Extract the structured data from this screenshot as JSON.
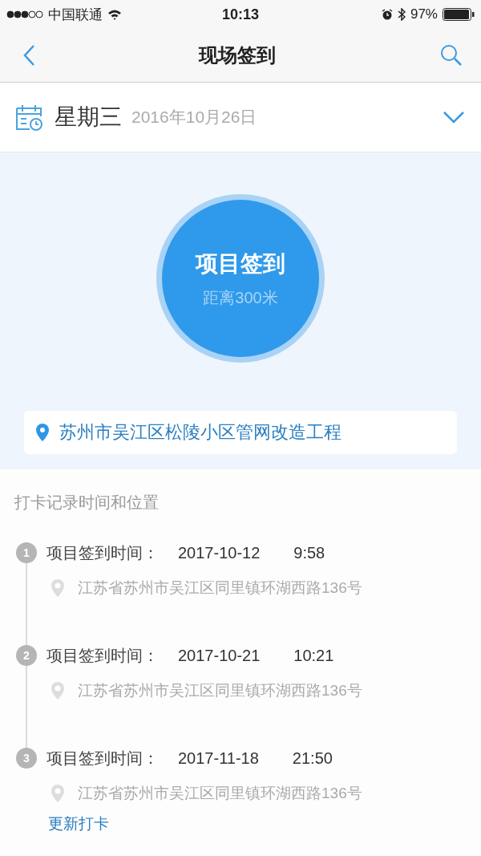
{
  "status_bar": {
    "carrier": "中国联通",
    "time": "10:13",
    "battery": "97%"
  },
  "nav": {
    "title": "现场签到"
  },
  "date_bar": {
    "weekday": "星期三",
    "date": "2016年10月26日"
  },
  "checkin": {
    "title": "项目签到",
    "distance": "距离300米"
  },
  "location": "苏州市吴江区松陵小区管网改造工程",
  "records_title": "打卡记录时间和位置",
  "records": [
    {
      "index": "1",
      "label": "项目签到时间：",
      "date": "2017-10-12",
      "time": "9:58",
      "address": "江苏省苏州市吴江区同里镇环湖西路136号"
    },
    {
      "index": "2",
      "label": "项目签到时间：",
      "date": "2017-10-21",
      "time": "10:21",
      "address": "江苏省苏州市吴江区同里镇环湖西路136号"
    },
    {
      "index": "3",
      "label": "项目签到时间：",
      "date": "2017-11-18",
      "time": "21:50",
      "address": "江苏省苏州市吴江区同里镇环湖西路136号"
    }
  ],
  "update_link": "更新打卡"
}
